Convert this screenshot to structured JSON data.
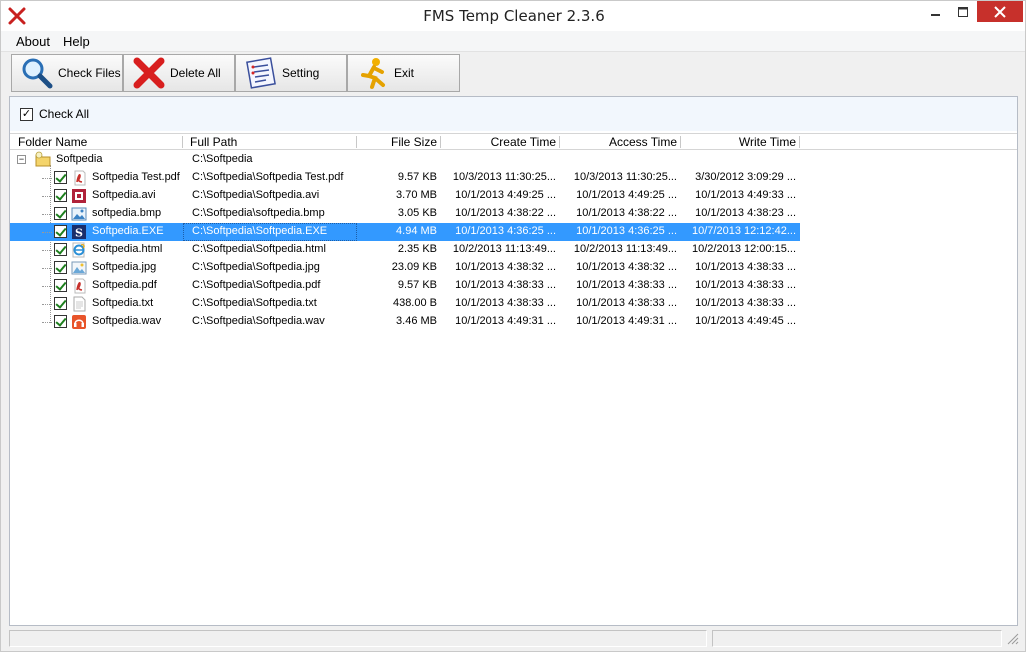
{
  "window": {
    "title": "FMS Temp Cleaner 2.3.6",
    "accent_close": "#c7302b"
  },
  "menu": {
    "items": [
      {
        "label": "About"
      },
      {
        "label": "Help"
      }
    ]
  },
  "toolbar": {
    "check_files": "Check Files",
    "delete_all": "Delete All",
    "setting": "Setting",
    "exit": "Exit"
  },
  "panel": {
    "check_all_label": "Check All",
    "check_all_checked": true
  },
  "grid": {
    "columns": {
      "folder_name": "Folder Name",
      "full_path": "Full Path",
      "file_size": "File Size",
      "create_time": "Create Time",
      "access_time": "Access Time",
      "write_time": "Write Time"
    },
    "root": {
      "name": "Softpedia",
      "path": "C:\\Softpedia",
      "icon": "folder-icon"
    },
    "files": [
      {
        "name": "Softpedia Test.pdf",
        "path": "C:\\Softpedia\\Softpedia Test.pdf",
        "size": "9.57 KB",
        "create": "10/3/2013 11:30:25...",
        "access": "10/3/2013 11:30:25...",
        "write": "3/30/2012 3:09:29 ...",
        "icon": "pdf-icon",
        "checked": true,
        "selected": false
      },
      {
        "name": "Softpedia.avi",
        "path": "C:\\Softpedia\\Softpedia.avi",
        "size": "3.70 MB",
        "create": "10/1/2013 4:49:25 ...",
        "access": "10/1/2013 4:49:25 ...",
        "write": "10/1/2013 4:49:33 ...",
        "icon": "video-icon",
        "checked": true,
        "selected": false
      },
      {
        "name": "softpedia.bmp",
        "path": "C:\\Softpedia\\softpedia.bmp",
        "size": "3.05 KB",
        "create": "10/1/2013 4:38:22 ...",
        "access": "10/1/2013 4:38:22 ...",
        "write": "10/1/2013 4:38:23 ...",
        "icon": "image-icon",
        "checked": true,
        "selected": false
      },
      {
        "name": "Softpedia.EXE",
        "path": "C:\\Softpedia\\Softpedia.EXE",
        "size": "4.94 MB",
        "create": "10/1/2013 4:36:25 ...",
        "access": "10/1/2013 4:36:25 ...",
        "write": "10/7/2013 12:12:42...",
        "icon": "exe-icon",
        "checked": true,
        "selected": true
      },
      {
        "name": "Softpedia.html",
        "path": "C:\\Softpedia\\Softpedia.html",
        "size": "2.35 KB",
        "create": "10/2/2013 11:13:49...",
        "access": "10/2/2013 11:13:49...",
        "write": "10/2/2013 12:00:15...",
        "icon": "html-icon",
        "checked": true,
        "selected": false
      },
      {
        "name": "Softpedia.jpg",
        "path": "C:\\Softpedia\\Softpedia.jpg",
        "size": "23.09 KB",
        "create": "10/1/2013 4:38:32 ...",
        "access": "10/1/2013 4:38:32 ...",
        "write": "10/1/2013 4:38:33 ...",
        "icon": "jpg-icon",
        "checked": true,
        "selected": false
      },
      {
        "name": "Softpedia.pdf",
        "path": "C:\\Softpedia\\Softpedia.pdf",
        "size": "9.57 KB",
        "create": "10/1/2013 4:38:33 ...",
        "access": "10/1/2013 4:38:33 ...",
        "write": "10/1/2013 4:38:33 ...",
        "icon": "pdf-icon",
        "checked": true,
        "selected": false
      },
      {
        "name": "Softpedia.txt",
        "path": "C:\\Softpedia\\Softpedia.txt",
        "size": "438.00 B",
        "create": "10/1/2013 4:38:33 ...",
        "access": "10/1/2013 4:38:33 ...",
        "write": "10/1/2013 4:38:33 ...",
        "icon": "text-icon",
        "checked": true,
        "selected": false
      },
      {
        "name": "Softpedia.wav",
        "path": "C:\\Softpedia\\Softpedia.wav",
        "size": "3.46 MB",
        "create": "10/1/2013 4:49:31 ...",
        "access": "10/1/2013 4:49:31 ...",
        "write": "10/1/2013 4:49:45 ...",
        "icon": "audio-icon",
        "checked": true,
        "selected": false
      }
    ]
  },
  "colors": {
    "selection": "#3399ff",
    "check_mark": "#1d7f1d"
  }
}
